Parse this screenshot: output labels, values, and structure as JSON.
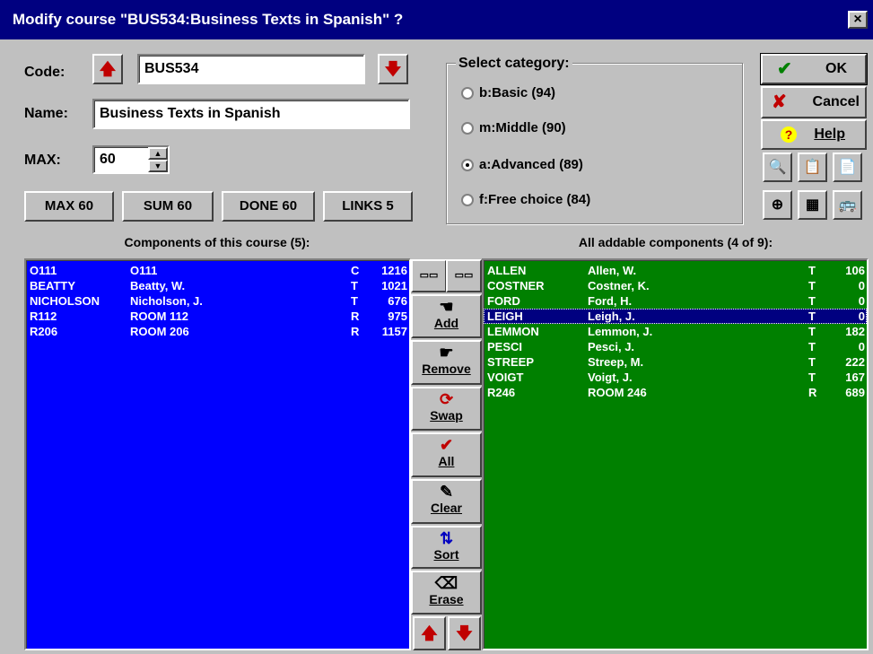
{
  "window": {
    "title": "Modify course \"BUS534:Business Texts in Spanish\" ?",
    "close": "×"
  },
  "form": {
    "code_label": "Code:",
    "code_value": "BUS534",
    "name_label": "Name:",
    "name_value": "Business Texts in Spanish",
    "max_label": "MAX:",
    "max_value": "60"
  },
  "stats": [
    "MAX 60",
    "SUM 60",
    "DONE 60",
    "LINKS 5"
  ],
  "category": {
    "label": "Select category:",
    "options": [
      "b:Basic (94)",
      "m:Middle (90)",
      "a:Advanced (89)",
      "f:Free choice (84)"
    ],
    "selected_index": 2
  },
  "actions": {
    "ok": "OK",
    "cancel": "Cancel",
    "help": "Help"
  },
  "left_list": {
    "header": "Components of this course (5):",
    "rows": [
      {
        "code": "O111",
        "name": "O111",
        "type": "C",
        "num": "1216"
      },
      {
        "code": "BEATTY",
        "name": "Beatty, W.",
        "type": "T",
        "num": "1021"
      },
      {
        "code": "NICHOLSON",
        "name": "Nicholson, J.",
        "type": "T",
        "num": "676"
      },
      {
        "code": "R112",
        "name": "ROOM 112",
        "type": "R",
        "num": "975"
      },
      {
        "code": "R206",
        "name": "ROOM 206",
        "type": "R",
        "num": "1157"
      }
    ]
  },
  "right_list": {
    "header": "All addable components (4 of 9):",
    "rows": [
      {
        "code": "ALLEN",
        "name": "Allen, W.",
        "type": "T",
        "num": "106"
      },
      {
        "code": "COSTNER",
        "name": "Costner, K.",
        "type": "T",
        "num": "0"
      },
      {
        "code": "FORD",
        "name": "Ford, H.",
        "type": "T",
        "num": "0"
      },
      {
        "code": "LEIGH",
        "name": "Leigh, J.",
        "type": "T",
        "num": "0"
      },
      {
        "code": "LEMMON",
        "name": "Lemmon, J.",
        "type": "T",
        "num": "182"
      },
      {
        "code": "PESCI",
        "name": "Pesci, J.",
        "type": "T",
        "num": "0"
      },
      {
        "code": "STREEP",
        "name": "Streep, M.",
        "type": "T",
        "num": "222"
      },
      {
        "code": "VOIGT",
        "name": "Voigt, J.",
        "type": "T",
        "num": "167"
      },
      {
        "code": "R246",
        "name": "ROOM 246",
        "type": "R",
        "num": "689"
      }
    ],
    "selected_index": 3
  },
  "middle_buttons": [
    "Add",
    "Remove",
    "Swap",
    "All",
    "Clear",
    "Sort",
    "Erase"
  ],
  "colors": {
    "left_bg": "#0000ff",
    "right_bg": "#008000",
    "title_bg": "#000080"
  }
}
